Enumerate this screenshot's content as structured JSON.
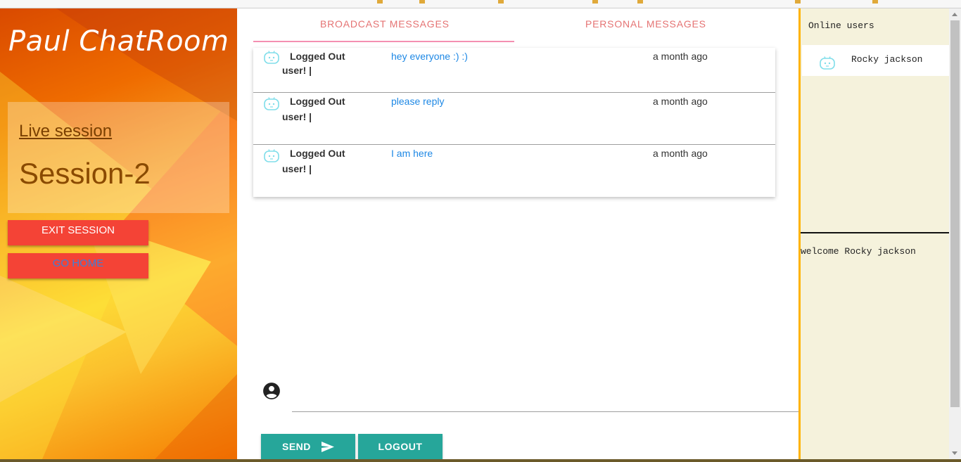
{
  "sidebar": {
    "brand": "Paul ChatRoom",
    "session_link": "Live session",
    "session_name": "Session-2",
    "exit_label": "EXIT SESSION",
    "home_label": "GO HOME"
  },
  "tabs": [
    {
      "label": "BROADCAST MESSAGES",
      "active": true
    },
    {
      "label": "PERSONAL MESSAGES",
      "active": false
    }
  ],
  "messages": [
    {
      "user_line1": "Logged Out",
      "user_line2": "user! |",
      "text": "hey everyone :) :)",
      "time": "a month ago",
      "icon": "robot-avatar-icon"
    },
    {
      "user_line1": "Logged Out",
      "user_line2": "user! |",
      "text": "please reply",
      "time": "a month ago",
      "icon": "robot-avatar-icon"
    },
    {
      "user_line1": "Logged Out",
      "user_line2": "user! |",
      "text": "I am here",
      "time": "a month ago",
      "icon": "robot-avatar-icon"
    }
  ],
  "composer": {
    "placeholder": "",
    "send_label": "SEND",
    "logout_label": "LOGOUT",
    "account_icon": "account-circle-icon",
    "send_icon": "send-icon"
  },
  "online": {
    "title": "Online users",
    "users": [
      {
        "name": "Rocky jackson",
        "icon": "robot-avatar-icon"
      }
    ],
    "welcome": "welcome Rocky jackson"
  },
  "colors": {
    "tab_accent": "#e57373",
    "red_button": "#f44336",
    "teal_button": "#26a69a",
    "message_text": "#1e88e5",
    "right_panel_bg": "#f5f2dc",
    "right_panel_border": "#ffb300"
  }
}
